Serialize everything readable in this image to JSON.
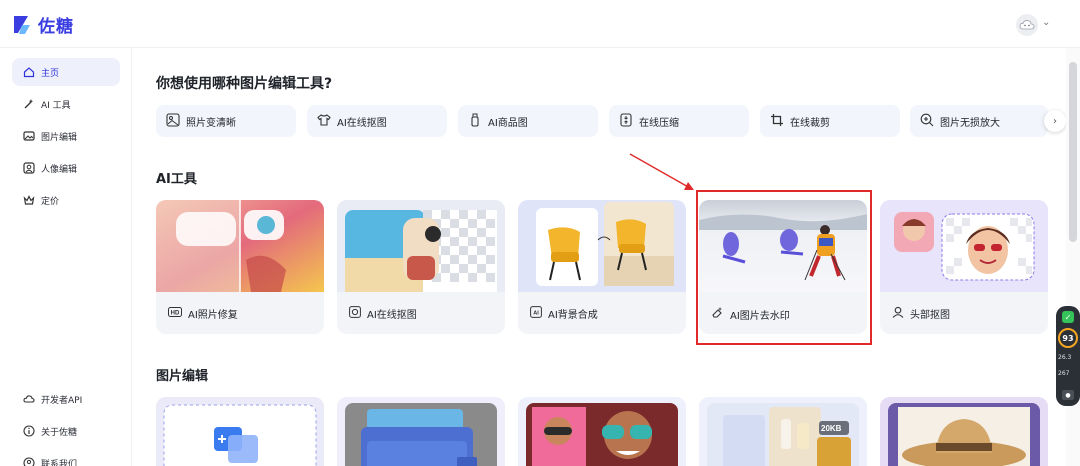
{
  "app": {
    "name": "佐糖"
  },
  "sidebar": {
    "items": [
      {
        "label": "主页",
        "icon": "home-icon",
        "active": true
      },
      {
        "label": "AI 工具",
        "icon": "magic-wand-icon"
      },
      {
        "label": "图片编辑",
        "icon": "image-edit-icon"
      },
      {
        "label": "人像编辑",
        "icon": "portrait-icon"
      },
      {
        "label": "定价",
        "icon": "crown-icon"
      }
    ],
    "bottom": [
      {
        "label": "开发者API",
        "icon": "cloud-api-icon"
      },
      {
        "label": "关于佐糖",
        "icon": "info-icon"
      },
      {
        "label": "联系我们",
        "icon": "contact-icon"
      }
    ]
  },
  "main": {
    "question": "你想使用哪种图片编辑工具?",
    "quick_tools": [
      {
        "label": "照片变清晰",
        "icon": "enhance-icon"
      },
      {
        "label": "AI在线抠图",
        "icon": "tshirt-icon"
      },
      {
        "label": "AI商品图",
        "icon": "bottle-icon"
      },
      {
        "label": "在线压缩",
        "icon": "compress-icon"
      },
      {
        "label": "在线裁剪",
        "icon": "crop-icon"
      },
      {
        "label": "图片无损放大",
        "icon": "zoom-in-icon"
      }
    ],
    "ai_section_title": "AI工具",
    "ai_tools": [
      {
        "label": "AI照片修复",
        "icon": "hd-icon"
      },
      {
        "label": "AI在线抠图",
        "icon": "cutout-icon"
      },
      {
        "label": "AI背景合成",
        "icon": "ai-bg-icon"
      },
      {
        "label": "AI图片去水印",
        "icon": "eraser-icon"
      },
      {
        "label": "头部抠图",
        "icon": "head-icon"
      }
    ],
    "edit_section_title": "图片编辑",
    "edit_cards": [
      {
        "badge": ""
      },
      {
        "badge": ""
      },
      {
        "badge": ""
      },
      {
        "badge": "20KB"
      },
      {
        "badge": ""
      }
    ]
  },
  "widget": {
    "score": "93",
    "line1": "26.3",
    "line2": "267"
  },
  "colors": {
    "accent": "#2f34d8",
    "highlight": "#e02a2a",
    "card_bg": "#f3f4f8"
  }
}
